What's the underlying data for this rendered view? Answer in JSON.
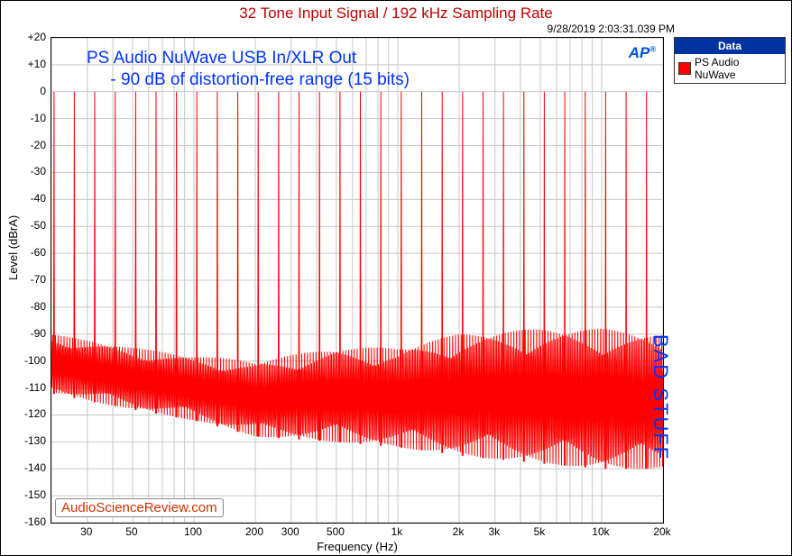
{
  "title": "32 Tone Input Signal / 192 kHz Sampling Rate",
  "timestamp": "9/28/2019 2:03:31.039 PM",
  "legend": {
    "header": "Data",
    "series_label": "PS Audio NuWave"
  },
  "annotations": {
    "main": "PS Audio NuWave USB In/XLR Out\n     - 90 dB of distortion-free range (15 bits)",
    "bad": "BAD STUFF",
    "watermark": "AudioScienceReview.com",
    "ap": "AP"
  },
  "axes": {
    "xlabel": "Frequency (Hz)",
    "ylabel": "Level (dBrA)",
    "ylim": [
      -160,
      20
    ],
    "xlim": [
      20,
      20000
    ],
    "yticks": [
      20,
      10,
      0,
      -10,
      -20,
      -30,
      -40,
      -50,
      -60,
      -70,
      -80,
      -90,
      -100,
      -110,
      -120,
      -130,
      -140,
      -150,
      -160
    ],
    "ytick_labels": [
      "+20",
      "+10",
      "0",
      "-10",
      "-20",
      "-30",
      "-40",
      "-50",
      "-60",
      "-70",
      "-80",
      "-90",
      "-100",
      "-110",
      "-120",
      "-130",
      "-140",
      "-150",
      "-160"
    ],
    "xticks": [
      30,
      50,
      100,
      200,
      300,
      500,
      1000,
      2000,
      3000,
      5000,
      10000,
      20000
    ],
    "xtick_labels": [
      "30",
      "50",
      "100",
      "200",
      "300",
      "500",
      "1k",
      "2k",
      "3k",
      "5k",
      "10k",
      "20k"
    ]
  },
  "chart_data": {
    "type": "line",
    "title": "32 Tone Input Signal / 192 kHz Sampling Rate",
    "xlabel": "Frequency (Hz)",
    "ylabel": "Level (dBrA)",
    "x_scale": "log",
    "ylim": [
      -160,
      20
    ],
    "xlim": [
      20,
      20000
    ],
    "series": [
      {
        "name": "PS Audio NuWave",
        "tone_frequencies_hz": [
          20.6,
          25.9,
          32.6,
          41.1,
          51.8,
          65.2,
          82.1,
          103.4,
          130.2,
          164.1,
          206.6,
          260.3,
          327.9,
          413.1,
          520.4,
          655.4,
          825.7,
          1040.3,
          1310.3,
          1650.6,
          2079.5,
          2619.2,
          3299.0,
          4155.8,
          5235.1,
          6594.6,
          8307.4,
          10464.0,
          13181.0,
          16601.7,
          20000.0
        ],
        "tone_level_db": 0,
        "noise_floor_envelope": {
          "x_hz": [
            20,
            50,
            100,
            200,
            500,
            1000,
            2000,
            5000,
            10000,
            20000
          ],
          "upper_db": [
            -90,
            -95,
            -98,
            -100,
            -95,
            -95,
            -90,
            -88,
            -88,
            -90
          ],
          "lower_db": [
            -112,
            -118,
            -122,
            -128,
            -130,
            -132,
            -135,
            -138,
            -140,
            -140
          ]
        }
      }
    ]
  }
}
